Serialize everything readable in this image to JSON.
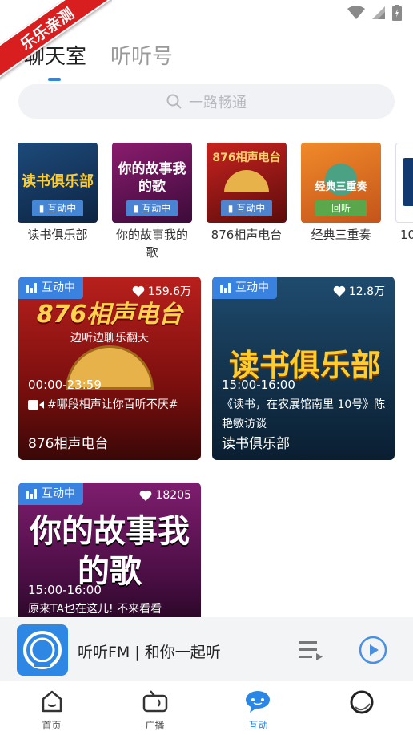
{
  "status": {
    "ribbon_text": "乐乐亲测"
  },
  "tabs": [
    {
      "label": "聊天室",
      "active": true
    },
    {
      "label": "听听号",
      "active": false
    }
  ],
  "search": {
    "placeholder": "一路畅通"
  },
  "featured": [
    {
      "label": "读书俱乐部",
      "badge": "互动中",
      "art_text": "读书俱乐部"
    },
    {
      "label": "你的故事我的歌",
      "badge": "互动中",
      "art_text": "你的故事我的歌"
    },
    {
      "label": "876相声电台",
      "badge": "互动中",
      "art_text": "876相声电台"
    },
    {
      "label": "经典三重奏",
      "badge": "回听",
      "art_text": "经典三重奏"
    },
    {
      "label": "10",
      "badge": "",
      "art_text": ""
    }
  ],
  "cards": [
    {
      "status": "互动中",
      "likes": "159.6万",
      "time": "00:00-23:59",
      "desc": "#哪段相声让你百听不厌#",
      "name": "876相声电台",
      "art_title": "876相声电台",
      "art_sub": "边听边聊乐翻天"
    },
    {
      "status": "互动中",
      "likes": "12.8万",
      "time": "15:00-16:00",
      "desc": "《读书，在农展馆南里 10号》陈艳敏访谈",
      "name": "读书俱乐部",
      "art_title": "读书俱乐部",
      "art_sub": ""
    },
    {
      "status": "互动中",
      "likes": "18205",
      "time": "15:00-16:00",
      "desc": "原来TA也在这儿!  不来看看",
      "name": "",
      "art_title": "你的故事我的歌",
      "art_sub": ""
    }
  ],
  "player": {
    "title": "听听FM | 和你一起听"
  },
  "nav": [
    {
      "label": "首页",
      "icon": "home-icon",
      "active": false
    },
    {
      "label": "广播",
      "icon": "radio-icon",
      "active": false
    },
    {
      "label": "互动",
      "icon": "chat-icon",
      "active": true
    },
    {
      "label": "",
      "icon": "profile-icon",
      "active": false
    }
  ],
  "colors": {
    "accent": "#2b86e5",
    "live_badge": "#3a82df",
    "ribbon": "#d81e1e"
  }
}
